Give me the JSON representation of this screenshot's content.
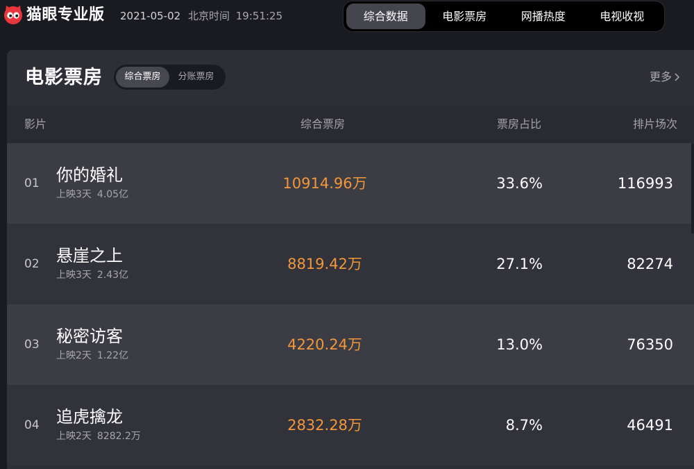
{
  "app": {
    "logo_text": "猫眼专业版",
    "date": "2021-05-02",
    "timezone_label": "北京时间",
    "time": "19:51:25",
    "accent_color": "#e9353c"
  },
  "nav": {
    "tabs": [
      {
        "label": "综合数据",
        "active": true
      },
      {
        "label": "电影票房",
        "active": false
      },
      {
        "label": "网播热度",
        "active": false
      },
      {
        "label": "电视收视",
        "active": false
      }
    ]
  },
  "panel": {
    "title": "电影票房",
    "subtabs": [
      {
        "label": "综合票房",
        "active": true
      },
      {
        "label": "分账票房",
        "active": false
      }
    ],
    "more_label": "更多"
  },
  "table": {
    "columns": [
      "影片",
      "综合票房",
      "票房占比",
      "排片场次"
    ],
    "rows": [
      {
        "rank": "01",
        "name": "你的婚礼",
        "days": "上映3天",
        "total": "4.05亿",
        "boxoffice": "10914.96万",
        "ratio": "33.6%",
        "shows": "116993"
      },
      {
        "rank": "02",
        "name": "悬崖之上",
        "days": "上映3天",
        "total": "2.43亿",
        "boxoffice": "8819.42万",
        "ratio": "27.1%",
        "shows": "82274"
      },
      {
        "rank": "03",
        "name": "秘密访客",
        "days": "上映2天",
        "total": "1.22亿",
        "boxoffice": "4220.24万",
        "ratio": "13.0%",
        "shows": "76350"
      },
      {
        "rank": "04",
        "name": "追虎擒龙",
        "days": "上映2天",
        "total": "8282.2万",
        "boxoffice": "2832.28万",
        "ratio": "8.7%",
        "shows": "46491"
      }
    ]
  },
  "colors": {
    "boxoffice": "#f2973a",
    "background": "#1a1b20",
    "panel": "#2e2f36"
  }
}
